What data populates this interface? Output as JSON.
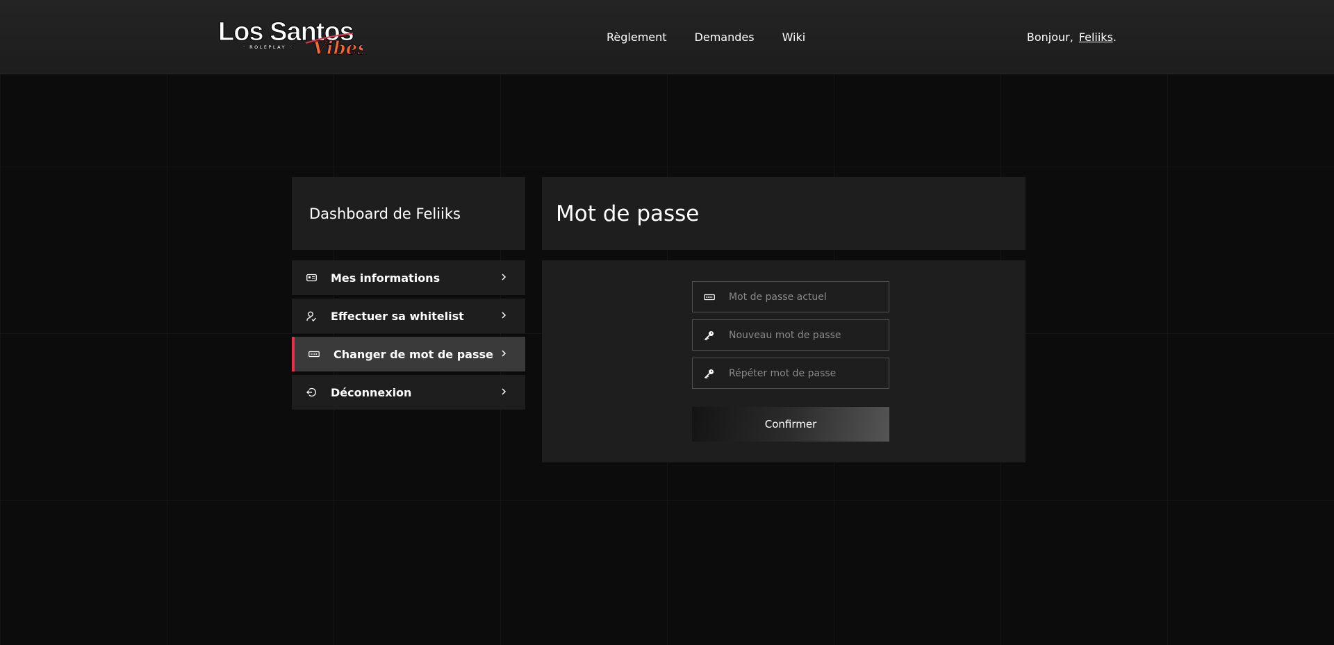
{
  "header": {
    "logo": {
      "main_text": "Los Santos",
      "sub_text": "· ROLEPLAY ·",
      "script_text": "Vibes"
    },
    "nav": [
      {
        "label": "Règlement"
      },
      {
        "label": "Demandes"
      },
      {
        "label": "Wiki"
      }
    ],
    "greeting": "Bonjour,",
    "username": "Feliiks",
    "greeting_suffix": "."
  },
  "sidebar": {
    "title": "Dashboard de Feliiks",
    "items": [
      {
        "label": "Mes informations",
        "icon": "id-card-icon",
        "active": false
      },
      {
        "label": "Effectuer sa whitelist",
        "icon": "user-check-icon",
        "active": false
      },
      {
        "label": "Changer de mot de passe",
        "icon": "password-icon",
        "active": true
      },
      {
        "label": "Déconnexion",
        "icon": "logout-icon",
        "active": false
      }
    ]
  },
  "main": {
    "title": "Mot de passe",
    "fields": {
      "current": {
        "placeholder": "Mot de passe actuel",
        "value": "",
        "icon": "password-icon"
      },
      "new": {
        "placeholder": "Nouveau mot de passe",
        "value": "",
        "icon": "key-icon"
      },
      "repeat": {
        "placeholder": "Répéter mot de passe",
        "value": "",
        "icon": "key-icon"
      }
    },
    "confirm_label": "Confirmer"
  },
  "colors": {
    "accent": "#e8304a",
    "background": "#0c0c0c",
    "panel": "#1e1e1e",
    "logo_orange": "#f06a3a"
  }
}
